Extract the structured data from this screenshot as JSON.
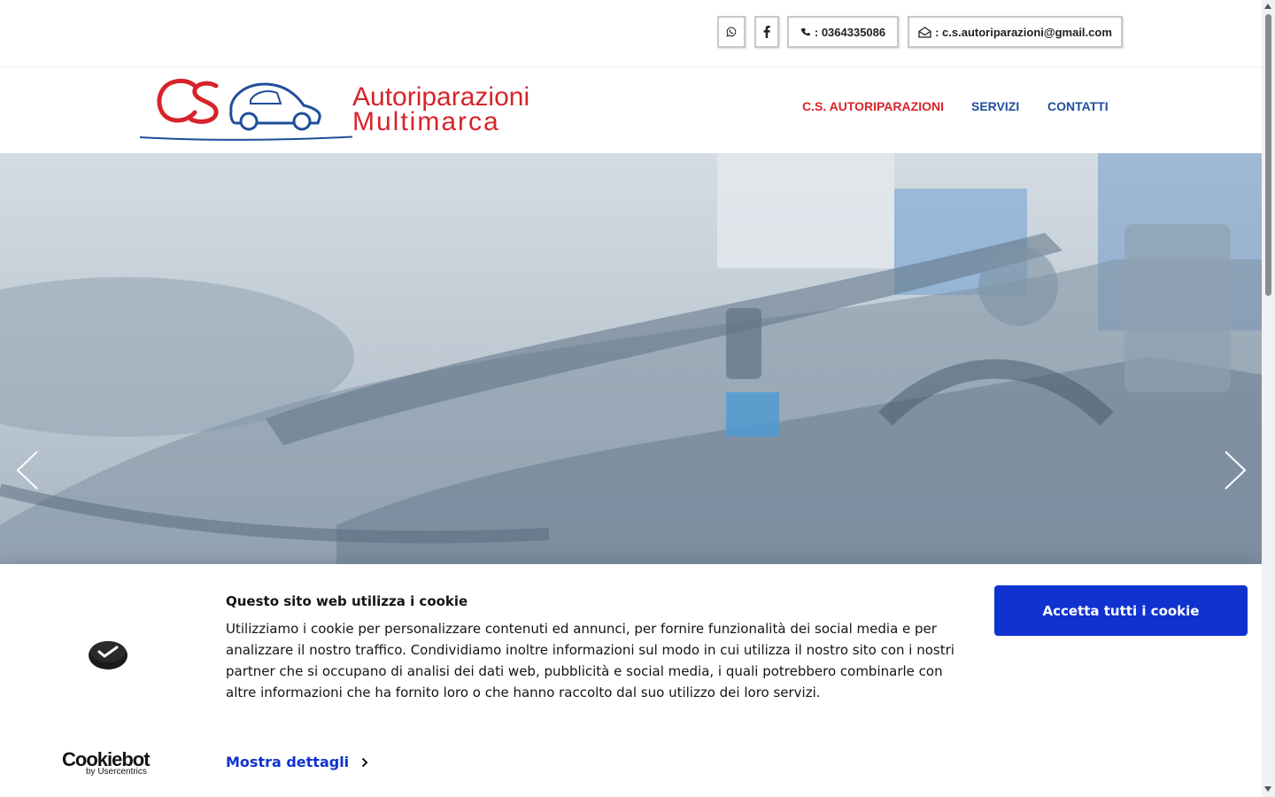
{
  "topbar": {
    "whatsapp_icon": "whatsapp-icon",
    "facebook_icon": "facebook-icon",
    "phone_label": ": 0364335086",
    "email_label": ": c.s.autoriparazioni@gmail.com"
  },
  "header": {
    "logo_line1": "Autoriparazioni",
    "logo_line2": "Multimarca",
    "nav": [
      "C.S. AUTORIPARAZIONI",
      "SERVIZI",
      "CONTATTI"
    ]
  },
  "hero": {
    "prev_icon": "chevron-left-icon",
    "next_icon": "chevron-right-icon"
  },
  "cookie": {
    "title": "Questo sito web utilizza i cookie",
    "body": "Utilizziamo i cookie per personalizzare contenuti ed annunci, per fornire funzionalità dei social media e per analizzare il nostro traffico. Condividiamo inoltre informazioni sul modo in cui utilizza il nostro sito con i nostri partner che si occupano di analisi dei dati web, pubblicità e social media, i quali potrebbero combinarle con altre informazioni che ha fornito loro o che hanno raccolto dal suo utilizzo dei loro servizi.",
    "details_label": "Mostra dettagli",
    "accept_label": "Accetta tutti i cookie",
    "brand": "Cookiebot",
    "brand_sub": "by Usercentrics"
  },
  "colors": {
    "brand_red": "#d8232a",
    "nav_blue": "#1f4e9a",
    "cookie_blue": "#1032cf"
  }
}
